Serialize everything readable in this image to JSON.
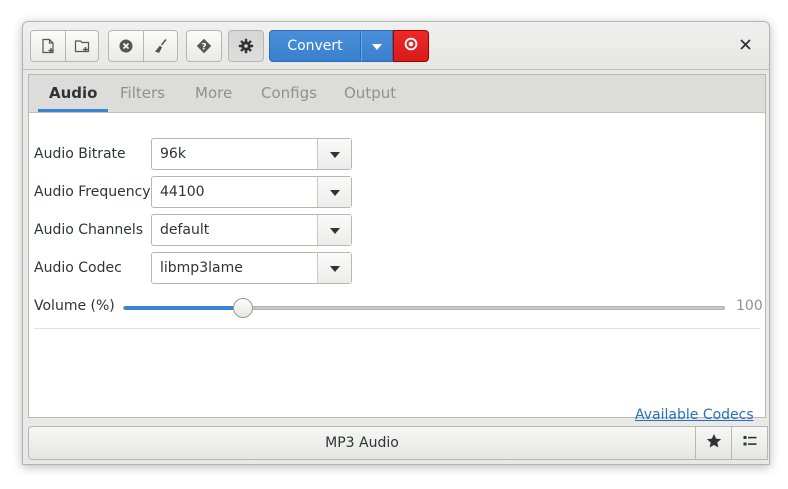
{
  "toolbar": {
    "icons": [
      "add-file-icon",
      "add-folder-icon",
      "clear-icon",
      "clean-icon",
      "help-icon",
      "settings-icon"
    ],
    "convert_label": "Convert",
    "accent_color": "#3b83d3",
    "stop_color": "#e02121"
  },
  "tabs": [
    {
      "label": "Audio",
      "active": true
    },
    {
      "label": "Filters",
      "active": false
    },
    {
      "label": "More",
      "active": false
    },
    {
      "label": "Configs",
      "active": false
    },
    {
      "label": "Output",
      "active": false
    }
  ],
  "audio": {
    "fields": [
      {
        "label": "Audio Bitrate",
        "value": "96k"
      },
      {
        "label": "Audio Frequency",
        "value": "44100"
      },
      {
        "label": "Audio Channels",
        "value": "default"
      },
      {
        "label": "Audio Codec",
        "value": "libmp3lame"
      }
    ],
    "volume": {
      "label": "Volume (%)",
      "value": 20,
      "max": 100,
      "max_label": "100"
    },
    "codecs_link": "Available Codecs"
  },
  "footer": {
    "preset": "MP3 Audio",
    "icons": [
      "star-icon",
      "list-icon"
    ]
  }
}
